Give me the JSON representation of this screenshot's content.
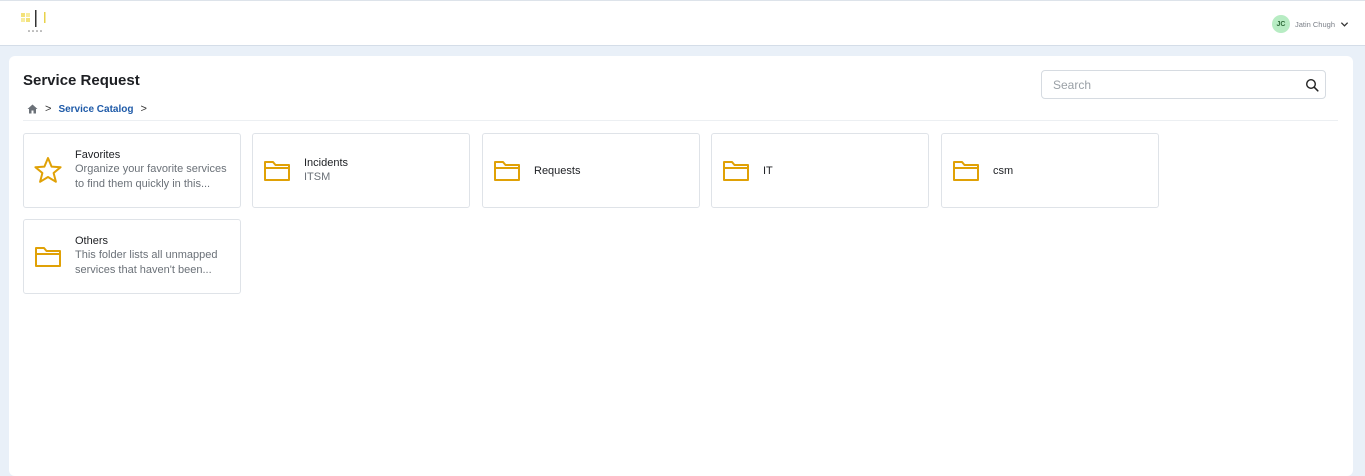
{
  "header": {
    "user": {
      "initials": "JC",
      "name": "Jatin Chugh"
    }
  },
  "page": {
    "title": "Service Request",
    "breadcrumb": {
      "sep1": ">",
      "link": "Service Catalog",
      "sep2": ">"
    },
    "search": {
      "placeholder": "Search",
      "value": ""
    }
  },
  "cards": [
    {
      "icon": "star-icon",
      "title": "Favorites",
      "desc1": "Organize your favorite services",
      "desc2": "to find them quickly in this..."
    },
    {
      "icon": "folder-icon",
      "title": "Incidents",
      "desc1": "ITSM"
    },
    {
      "icon": "folder-icon",
      "title": "Requests"
    },
    {
      "icon": "folder-icon",
      "title": "IT"
    },
    {
      "icon": "folder-icon",
      "title": "csm"
    },
    {
      "icon": "folder-icon",
      "title": "Others",
      "desc1": "This folder lists all unmapped",
      "desc2": "services that haven't been..."
    }
  ],
  "colors": {
    "accent": "#1e5aa8",
    "folder": "#e0a106",
    "avatar_bg": "#b7ecc3"
  }
}
